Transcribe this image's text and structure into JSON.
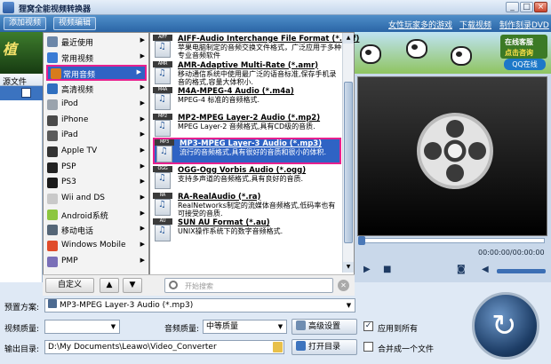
{
  "window": {
    "title": "狸窝全能视频转换器"
  },
  "toolbar": {
    "add_video": "添加视频",
    "edit_video": "视频编辑",
    "link_game": "女性玩家多的游戏",
    "link_download": "下载视频",
    "link_dvd": "制作刻录DVD"
  },
  "banner": {
    "left_text": "植",
    "online_service": "在线客服",
    "click_consult": "点击咨询",
    "qq_online": "QQ在线"
  },
  "left_pane": {
    "header": "源文件"
  },
  "categories": [
    {
      "label": "最近使用",
      "has_arrow": true,
      "icon_color": "#6b86a8"
    },
    {
      "label": "常用视频",
      "has_arrow": true,
      "icon_color": "#3a7bd5"
    },
    {
      "label": "常用音频",
      "has_arrow": true,
      "icon_color": "#d87b1c"
    },
    {
      "label": "高清视频",
      "has_arrow": true,
      "icon_color": "#2f6fbf"
    },
    {
      "label": "iPod",
      "has_arrow": true,
      "icon_color": "#9aa3ad"
    },
    {
      "label": "iPhone",
      "has_arrow": true,
      "icon_color": "#4a4a4a"
    },
    {
      "label": "iPad",
      "has_arrow": true,
      "icon_color": "#5a5a5a"
    },
    {
      "label": "Apple TV",
      "has_arrow": true,
      "icon_color": "#333333"
    },
    {
      "label": "PSP",
      "has_arrow": true,
      "icon_color": "#222222"
    },
    {
      "label": "PS3",
      "has_arrow": true,
      "icon_color": "#1a1a1a"
    },
    {
      "label": "Wii and DS",
      "has_arrow": true,
      "icon_color": "#c9c9c9"
    },
    {
      "label": "Android系统",
      "has_arrow": true,
      "icon_color": "#8cc63f"
    },
    {
      "label": "移动电话",
      "has_arrow": true,
      "icon_color": "#556677"
    },
    {
      "label": "Windows Mobile",
      "has_arrow": true,
      "icon_color": "#e04b2a"
    },
    {
      "label": "PMP",
      "has_arrow": true,
      "icon_color": "#7a6fb8"
    }
  ],
  "selected_category": 2,
  "formats": [
    {
      "tag": "AIFF",
      "title": "AIFF-Audio Interchange File Format (*.aiff)",
      "desc": "苹果电脑制定的音频交换文件格式，广泛应用于多种专业音频软件"
    },
    {
      "tag": "AMR",
      "title": "AMR-Adaptive Multi-Rate (*.amr)",
      "desc": "移动通信系统中使用最广泛的语音标准,保存手机录音的格式,容量大体积小."
    },
    {
      "tag": "M4A",
      "title": "M4A-MPEG-4 Audio (*.m4a)",
      "desc": "MPEG-4 标准的音频格式."
    },
    {
      "tag": "MP2",
      "title": "MP2-MPEG Layer-2 Audio (*.mp2)",
      "desc": "MPEG Layer-2 音频格式,具有CD级的音质."
    },
    {
      "tag": "MP3",
      "title": "MP3-MPEG Layer-3 Audio (*.mp3)",
      "desc": "流行的音频格式,具有很好的音质和很小的体积."
    },
    {
      "tag": "OGG",
      "title": "OGG-Ogg Vorbis Audio (*.ogg)",
      "desc": "支持多声道的音频格式,具有良好的音质."
    },
    {
      "tag": "RA",
      "title": "RA-RealAudio (*.ra)",
      "desc": "RealNetworks制定的流媒体音频格式,低码率也有可接受的音质."
    },
    {
      "tag": "AU",
      "title": "SUN AU Format (*.au)",
      "desc": "UNIX操作系统下的数字音频格式."
    }
  ],
  "selected_format": 4,
  "menu_bottom": {
    "custom_button": "自定义",
    "search_placeholder": "开始搜索"
  },
  "preview": {
    "time": "00:00:00/00:00:00"
  },
  "settings": {
    "preset_label": "预置方案:",
    "preset_value": "MP3-MPEG Layer-3 Audio (*.mp3)",
    "video_quality_label": "视频质量:",
    "video_quality_value": "",
    "audio_quality_label": "音频质量:",
    "audio_quality_value": "中等质量",
    "advanced_button": "高级设置",
    "apply_all_label": "应用到所有",
    "apply_all_checked": true,
    "output_label": "输出目录:",
    "output_path": "D:\\My Documents\\Leawo\\Video_Converter",
    "open_dir_button": "打开目录",
    "merge_label": "合并成一个文件",
    "merge_checked": false
  }
}
